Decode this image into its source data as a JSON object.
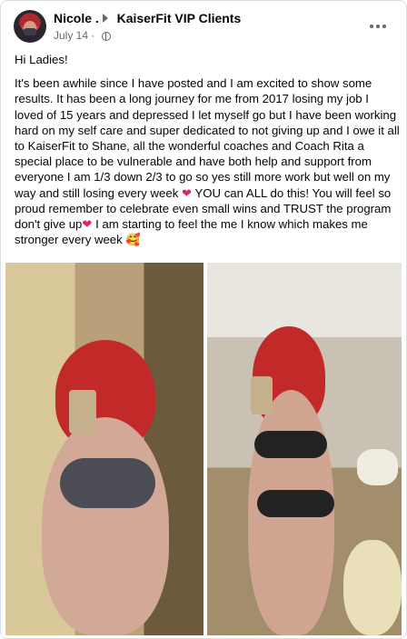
{
  "post": {
    "author": "Nicole .",
    "group": "KaiserFit VIP Clients",
    "date": "July 14 ·",
    "greeting": "Hi Ladies!",
    "text_part1": "It's been awhile since I have posted and I am excited to show some results. It has been a long journey for me from 2017 losing my job I loved of 15 years and depressed I let myself go but I have been working hard on my self care and super dedicated to not giving up and I owe it all to KaiserFit to Shane, all the wonderful coaches and Coach Rita a special place to be vulnerable and have both help and support from everyone I am 1/3 down 2/3 to go so yes still more work but well on my way and still losing every week",
    "text_part2": " YOU can ALL do this! You will feel so proud remember to celebrate even small wins and TRUST the program don't give up",
    "text_part3": " I am starting to feel the me I know which makes me stronger every week ",
    "emoji_heart": "❤",
    "emoji_smile": "🥰"
  },
  "icons": {
    "more": "more-options-icon",
    "globe": "public-globe-icon",
    "arrow": "group-arrow-icon"
  }
}
